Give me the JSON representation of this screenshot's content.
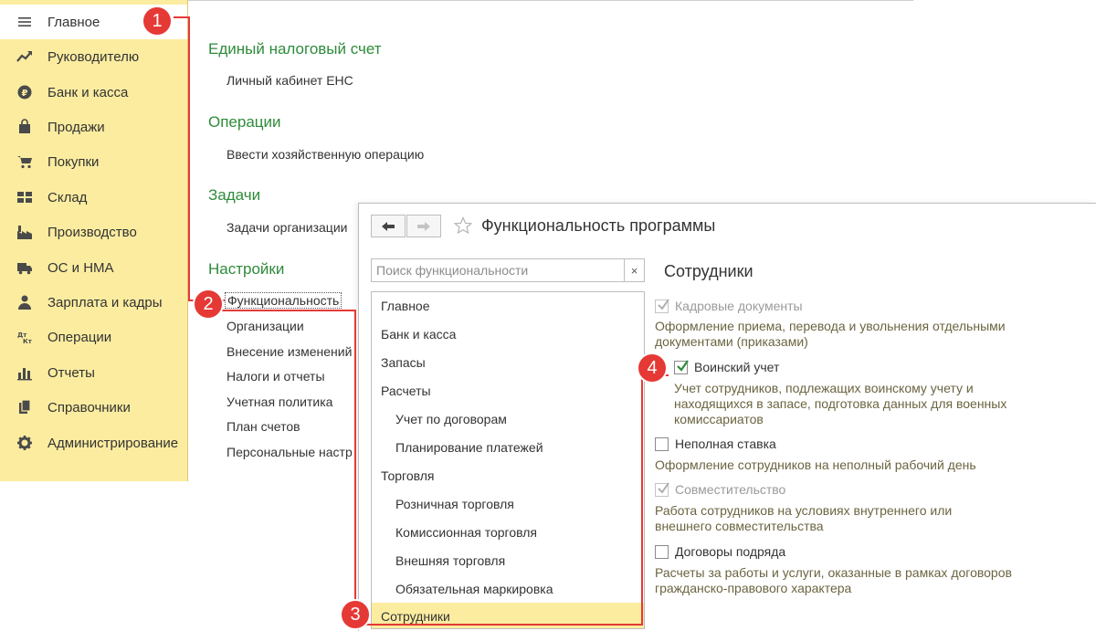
{
  "sidebar": {
    "items": [
      {
        "label": "Главное",
        "icon": "menu-icon",
        "active": true
      },
      {
        "label": "Руководителю",
        "icon": "trend-chart-icon"
      },
      {
        "label": "Банк и касса",
        "icon": "ruble-coin-icon"
      },
      {
        "label": "Продажи",
        "icon": "shopping-bag-icon"
      },
      {
        "label": "Покупки",
        "icon": "shopping-cart-icon"
      },
      {
        "label": "Склад",
        "icon": "warehouse-grid-icon"
      },
      {
        "label": "Производство",
        "icon": "factory-icon"
      },
      {
        "label": "ОС и НМА",
        "icon": "truck-icon"
      },
      {
        "label": "Зарплата и кадры",
        "icon": "person-icon"
      },
      {
        "label": "Операции",
        "icon": "debit-credit-icon"
      },
      {
        "label": "Отчеты",
        "icon": "bar-chart-icon"
      },
      {
        "label": "Справочники",
        "icon": "books-icon"
      },
      {
        "label": "Администрирование",
        "icon": "gear-icon"
      }
    ]
  },
  "main": {
    "ens": {
      "title": "Единый налоговый счет",
      "link": "Личный кабинет ЕНС"
    },
    "operations": {
      "title": "Операции",
      "link": "Ввести хозяйственную операцию"
    },
    "tasks": {
      "title": "Задачи",
      "link": "Задачи организации"
    },
    "settings": {
      "title": "Настройки",
      "links": [
        "Функциональность",
        "Организации",
        "Внесение изменений",
        "Налоги и отчеты",
        "Учетная политика",
        "План счетов",
        "Персональные настр"
      ]
    }
  },
  "dialog": {
    "title": "Функциональность программы",
    "search_placeholder": "Поиск функциональности",
    "clear_label": "×",
    "tree": [
      {
        "label": "Главное",
        "level": 0
      },
      {
        "label": "Банк и касса",
        "level": 0
      },
      {
        "label": "Запасы",
        "level": 0
      },
      {
        "label": "Расчеты",
        "level": 0
      },
      {
        "label": "Учет по договорам",
        "level": 1
      },
      {
        "label": "Планирование платежей",
        "level": 1
      },
      {
        "label": "Торговля",
        "level": 0
      },
      {
        "label": "Розничная торговля",
        "level": 1
      },
      {
        "label": "Комиссионная торговля",
        "level": 1
      },
      {
        "label": "Внешняя торговля",
        "level": 1
      },
      {
        "label": "Обязательная маркировка",
        "level": 1
      },
      {
        "label": "Сотрудники",
        "level": 0,
        "selected": true
      }
    ],
    "section_title": "Сотрудники",
    "options": [
      {
        "label": "Кадровые документы",
        "checked": true,
        "disabled": true,
        "desc": "Оформление приема, перевода и увольнения отдельными документами (приказами)"
      },
      {
        "label": "Воинский учет",
        "checked": true,
        "disabled": false,
        "desc": "Учет сотрудников, подлежащих воинскому учету и находящихся в запасе, подготовка данных для военных комиссариатов"
      },
      {
        "label": "Неполная ставка",
        "checked": false,
        "disabled": false,
        "desc": "Оформление сотрудников на неполный рабочий день"
      },
      {
        "label": "Совместительство",
        "checked": true,
        "disabled": true,
        "desc": "Работа сотрудников на условиях внутреннего или внешнего совместительства"
      },
      {
        "label": "Договоры подряда",
        "checked": false,
        "disabled": false,
        "desc": "Расчеты за работы и услуги, оказанные в рамках договоров гражданско-правового характера"
      }
    ]
  },
  "annotations": {
    "b1": "1",
    "b2": "2",
    "b3": "3",
    "b4": "4",
    "color": "#e53935"
  },
  "colors": {
    "sidebar_bg": "#fbeca0",
    "section_title": "#2e8b3a",
    "selected_row": "#fbeca0"
  }
}
